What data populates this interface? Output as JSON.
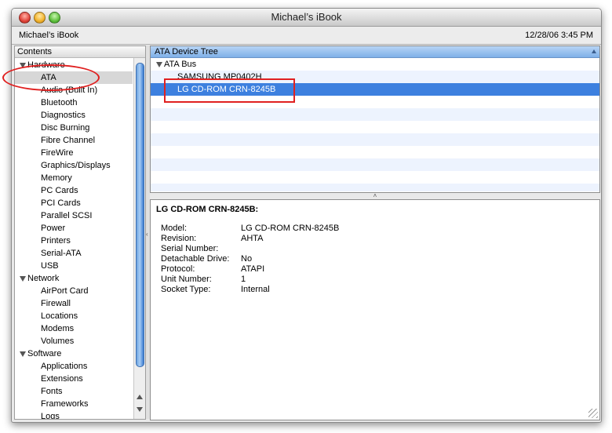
{
  "window": {
    "title": "Michael’s iBook"
  },
  "infobar": {
    "machine": "Michael’s iBook",
    "datetime": "12/28/06 3:45 PM"
  },
  "sidebar": {
    "header": "Contents",
    "groups": {
      "hardware": "Hardware",
      "network": "Network",
      "software": "Software"
    },
    "hardware_items": [
      "ATA",
      "Audio (Built In)",
      "Bluetooth",
      "Diagnostics",
      "Disc Burning",
      "Fibre Channel",
      "FireWire",
      "Graphics/Displays",
      "Memory",
      "PC Cards",
      "PCI Cards",
      "Parallel SCSI",
      "Power",
      "Printers",
      "Serial-ATA",
      "USB"
    ],
    "network_items": [
      "AirPort Card",
      "Firewall",
      "Locations",
      "Modems",
      "Volumes"
    ],
    "software_items": [
      "Applications",
      "Extensions",
      "Fonts",
      "Frameworks",
      "Logs"
    ],
    "selected": "ATA"
  },
  "tree": {
    "header": "ATA Device Tree",
    "bus": "ATA Bus",
    "devices": [
      "SAMSUNG MP0402H",
      "LG CD-ROM CRN-8245B"
    ],
    "selected": "LG CD-ROM CRN-8245B"
  },
  "details": {
    "title": "LG CD-ROM CRN-8245B:",
    "fields": [
      {
        "label": "Model:",
        "value": "LG CD-ROM CRN-8245B"
      },
      {
        "label": "Revision:",
        "value": "AHTA"
      },
      {
        "label": "Serial Number:",
        "value": ""
      },
      {
        "label": "Detachable Drive:",
        "value": "No"
      },
      {
        "label": "Protocol:",
        "value": "ATAPI"
      },
      {
        "label": "Unit Number:",
        "value": "1"
      },
      {
        "label": "Socket Type:",
        "value": "Internal"
      }
    ]
  },
  "colors": {
    "selection": "#3d80df",
    "annotation": "#e02020",
    "thumb": "#6aa2e0"
  }
}
